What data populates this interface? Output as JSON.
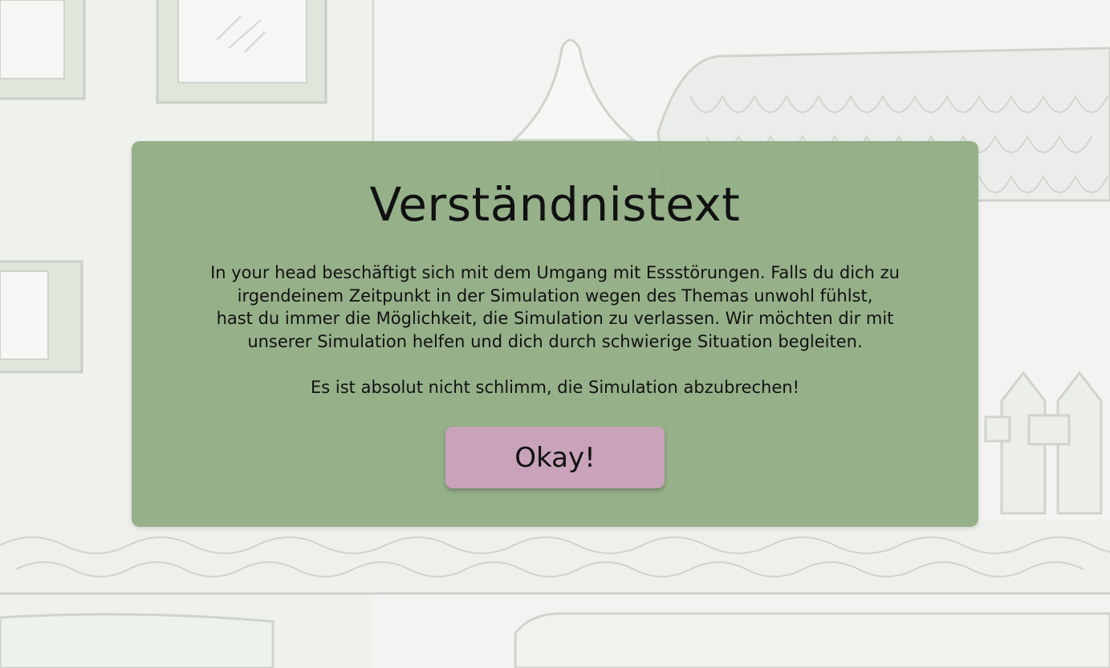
{
  "dialog": {
    "title": "Verständnistext",
    "body_lines": [
      "In your head beschäftigt sich mit dem Umgang mit Essstörungen. Falls du dich zu",
      "irgendeinem Zeitpunkt in der Simulation wegen des Themas unwohl fühlst,",
      "hast du immer die Möglichkeit, die Simulation zu verlassen. Wir möchten dir mit",
      "unserer Simulation helfen und dich durch schwierige Situation begleiten."
    ],
    "note": "Es ist absolut nicht schlimm, die Simulation abzubrechen!",
    "ok_label": "Okay!"
  },
  "colors": {
    "dialog_background": "#8caa7e",
    "button_background": "#c8a3b9",
    "scene_line": "#cfd2cc"
  }
}
